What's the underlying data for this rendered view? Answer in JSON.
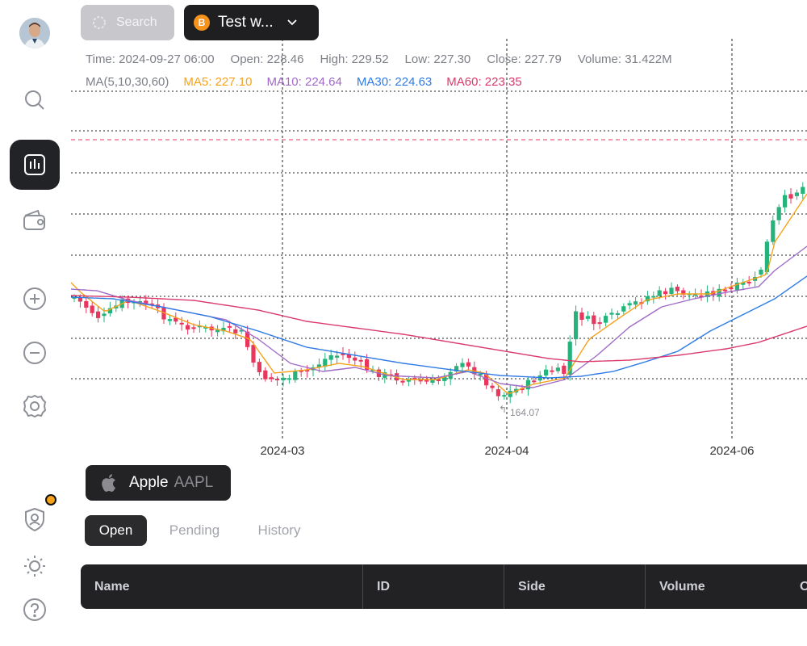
{
  "toolbar": {
    "search_label": "Search",
    "account_label": "Test w...",
    "account_icon_letter": "B"
  },
  "info": {
    "time": "Time: 2024-09-27 06:00",
    "open": "Open: 228.46",
    "high": "High: 229.52",
    "low": "Low: 227.30",
    "close": "Close: 227.79",
    "volume": "Volume: 31.422M",
    "ma_label": "MA(5,10,30,60)",
    "ma5": "MA5: 227.10",
    "ma10": "MA10: 224.64",
    "ma30": "MA30: 224.63",
    "ma60": "MA60: 223.35"
  },
  "colors": {
    "up": "#26b37b",
    "down": "#e8365d",
    "ma5": "#f5a21b",
    "ma10": "#a06ac7",
    "ma30": "#2f7be5",
    "ma60": "#d93a6b",
    "accent": "#f7a21b"
  },
  "chart_data": {
    "type": "candlestick",
    "x_labels": [
      "2024-03",
      "2024-04",
      "2024-06"
    ],
    "low_marker": "164.07",
    "grid": true
  },
  "symbol": {
    "name": "Apple",
    "ticker": "AAPL"
  },
  "tabs": [
    {
      "label": "Open"
    },
    {
      "label": "Pending"
    },
    {
      "label": "History"
    }
  ],
  "table": {
    "columns": [
      "Name",
      "ID",
      "Side",
      "Volume",
      "O"
    ]
  },
  "sidebar": {
    "icons": [
      "avatar",
      "search-icon",
      "chart-icon",
      "wallet-icon",
      "zoom-in-icon",
      "zoom-out-icon",
      "settings-icon",
      "account-shield-icon",
      "brightness-icon",
      "help-icon"
    ]
  }
}
